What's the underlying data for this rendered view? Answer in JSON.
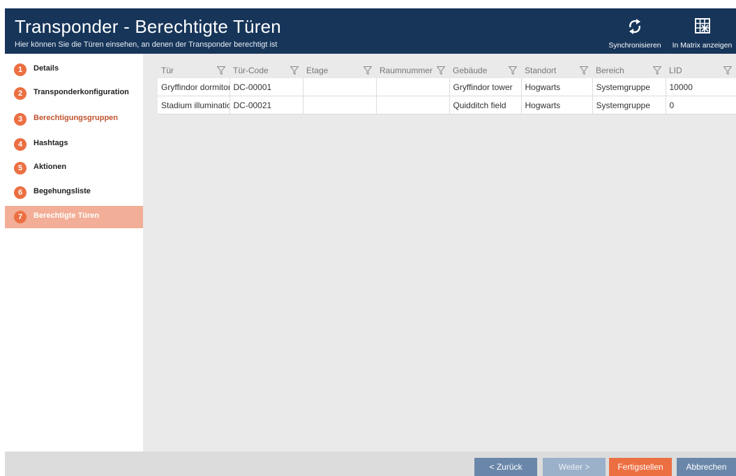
{
  "header": {
    "title": "Transponder - Berechtigte Türen",
    "subtitle": "Hier können Sie die Türen einsehen, an denen der Transponder berechtigt ist",
    "sync_label": "Synchronisieren",
    "sync_icon": "sync-icon",
    "matrix_label": "In Matrix anzeigen",
    "matrix_icon": "matrix-grid-icon",
    "background_color": "#173559"
  },
  "steps": [
    {
      "number": "1",
      "label": "Details",
      "state": "normal"
    },
    {
      "number": "2",
      "label": "Transponderkonfiguration",
      "state": "normal"
    },
    {
      "number": "3",
      "label": "Berechtigungsgruppen",
      "state": "visited"
    },
    {
      "number": "4",
      "label": "Hashtags",
      "state": "normal"
    },
    {
      "number": "5",
      "label": "Aktionen",
      "state": "normal"
    },
    {
      "number": "6",
      "label": "Begehungsliste",
      "state": "normal"
    },
    {
      "number": "7",
      "label": "Berechtigte Türen",
      "state": "active"
    }
  ],
  "table": {
    "columns": [
      "Tür",
      "Tür-Code",
      "Etage",
      "Raumnummer",
      "Gebäude",
      "Standort",
      "Bereich",
      "LID"
    ],
    "rows": [
      [
        "Gryffindor dormitory",
        "DC-00001",
        "",
        "",
        "Gryffindor tower",
        "Hogwarts",
        "Systemgruppe",
        "10000"
      ],
      [
        "Stadium illumination",
        "DC-00021",
        "",
        "",
        "Quidditch field",
        "Hogwarts",
        "Systemgruppe",
        "0"
      ]
    ],
    "filter_icon": "filter-icon"
  },
  "footer": {
    "back_label": "< Zurück",
    "next_label": "Weiter >",
    "finish_label": "Fertigstellen",
    "cancel_label": "Abbrechen"
  },
  "colors": {
    "accent": "#ec6f42",
    "active_step": "#f2ae96",
    "button_blue": "#6a87aa",
    "button_disabled": "#9bb0c9"
  }
}
